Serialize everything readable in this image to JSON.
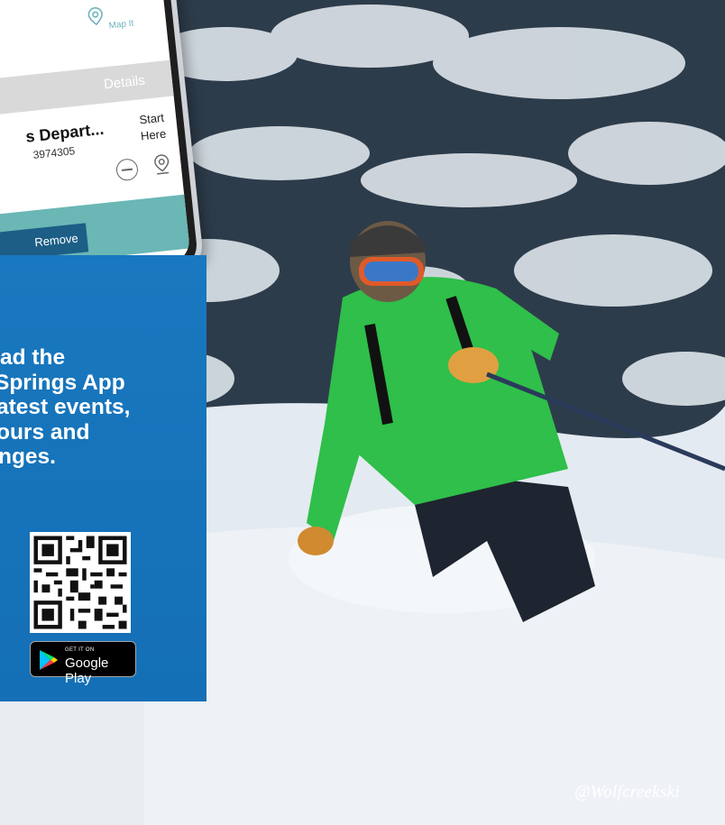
{
  "credit": "@Wolfcreekski",
  "phone": {
    "map_it_label": "Map It",
    "details_label": "Details",
    "row_title": "s Depart...",
    "row_phone": "3974305",
    "start_here": "Start Here",
    "remove_label": "Remove"
  },
  "promo": {
    "lines": [
      "ad the",
      "Springs App",
      "atest events,",
      "ours and",
      "nges."
    ],
    "qr_icon": "qr-code",
    "store_badge": {
      "small": "GET IT ON",
      "big": "Google Play"
    }
  },
  "colors": {
    "promo_blue": "#146fb6",
    "teal": "#6ab7b5",
    "remove_blue": "#1c5e86",
    "jacket_green": "#2fbf4a"
  }
}
